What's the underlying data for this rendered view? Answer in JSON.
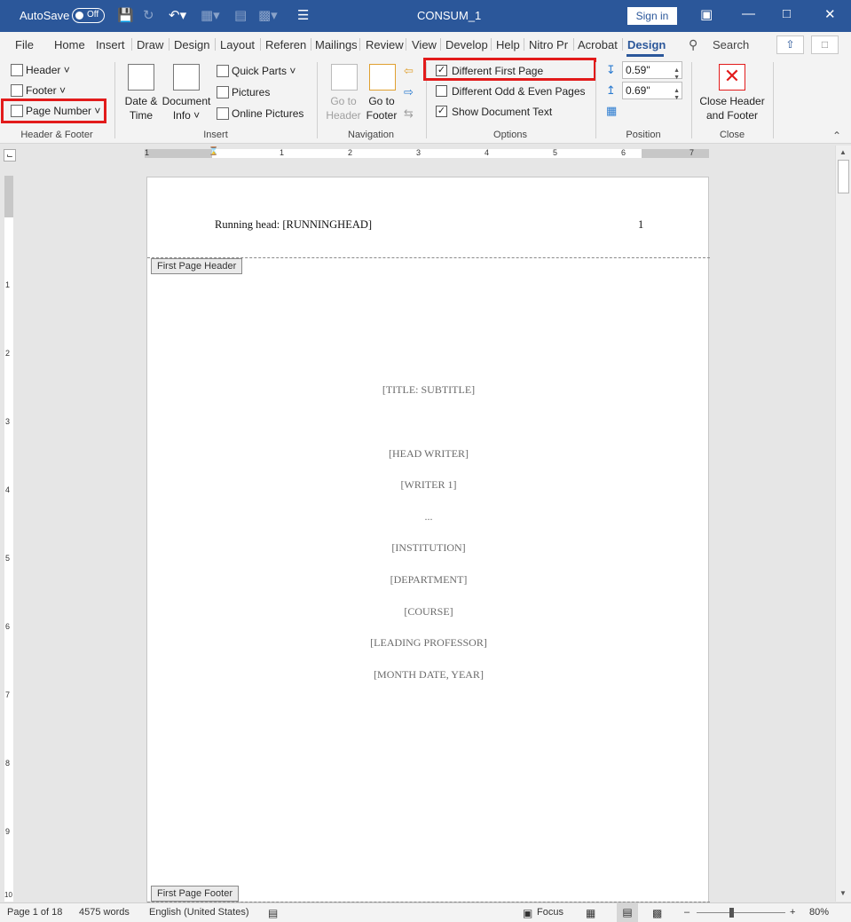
{
  "titlebar": {
    "autosave": "AutoSave",
    "autosave_state": "Off",
    "doc_title": "CONSUM_1",
    "sign_in": "Sign in"
  },
  "tabs": [
    {
      "label": "File"
    },
    {
      "label": "Home"
    },
    {
      "label": "Insert"
    },
    {
      "label": "Draw"
    },
    {
      "label": "Design"
    },
    {
      "label": "Layout"
    },
    {
      "label": "Referen"
    },
    {
      "label": "Mailings"
    },
    {
      "label": "Review"
    },
    {
      "label": "View"
    },
    {
      "label": "Develop"
    },
    {
      "label": "Help"
    },
    {
      "label": "Nitro Pr"
    },
    {
      "label": "Acrobat"
    },
    {
      "label": "Design"
    }
  ],
  "search": {
    "label": "Search"
  },
  "ribbon": {
    "header_footer": {
      "header": "Header",
      "footer": "Footer",
      "page_number": "Page Number",
      "group": "Header & Footer"
    },
    "insert": {
      "date_time_1": "Date &",
      "date_time_2": "Time",
      "doc_info_1": "Document",
      "doc_info_2": "Info",
      "quick_parts": "Quick Parts",
      "pictures": "Pictures",
      "online_pictures": "Online Pictures",
      "group": "Insert"
    },
    "navigation": {
      "go_header_1": "Go to",
      "go_header_2": "Header",
      "go_footer_1": "Go to",
      "go_footer_2": "Footer",
      "group": "Navigation"
    },
    "options": {
      "different_first_page": "Different First Page",
      "different_odd_even": "Different Odd & Even Pages",
      "show_document_text": "Show Document Text",
      "group": "Options"
    },
    "position": {
      "header_from_top": "0.59\"",
      "footer_from_bottom": "0.69\"",
      "group": "Position"
    },
    "close": {
      "close_1": "Close Header",
      "close_2": "and Footer",
      "group": "Close"
    }
  },
  "ruler": {
    "h_numbers": [
      "1",
      "1",
      "2",
      "3",
      "4",
      "5",
      "6",
      "7"
    ],
    "v_numbers": [
      "1",
      "2",
      "3",
      "4",
      "5",
      "6",
      "7",
      "8",
      "9",
      "10"
    ]
  },
  "document": {
    "header_text": "Running head: [RUNNINGHEAD]",
    "page_number": "1",
    "first_page_header_tag": "First Page Header",
    "first_page_footer_tag": "First Page Footer",
    "lines": [
      "[TITLE: SUBTITLE]",
      "[HEAD WRITER]",
      "[WRITER 1]",
      "...",
      "[INSTITUTION]",
      "[DEPARTMENT]",
      "[COURSE]",
      "[LEADING PROFESSOR]",
      "[MONTH DATE, YEAR]"
    ]
  },
  "status": {
    "page": "Page 1 of 18",
    "words": "4575 words",
    "language": "English (United States)",
    "focus": "Focus",
    "zoom": "80%"
  }
}
